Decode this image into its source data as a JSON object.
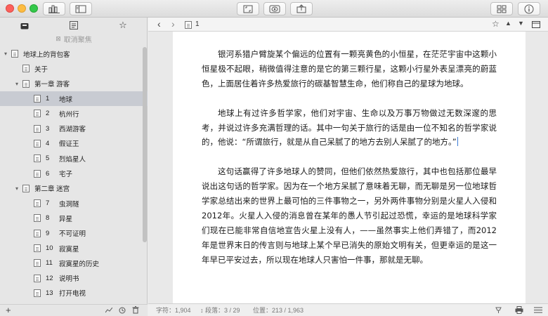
{
  "sidebar": {
    "unfocus_label": "取消聚焦",
    "items": [
      {
        "num": "",
        "label": "地球上的背包客",
        "level": 0,
        "disclosure": "▾",
        "selected": false
      },
      {
        "num": "",
        "label": "关于",
        "level": 1,
        "disclosure": "",
        "selected": false
      },
      {
        "num": "",
        "label": "第一章 游客",
        "level": 1,
        "disclosure": "▾",
        "selected": false
      },
      {
        "num": "1",
        "label": "地球",
        "level": 2,
        "disclosure": "",
        "selected": true
      },
      {
        "num": "2",
        "label": "杭州行",
        "level": 2,
        "disclosure": "",
        "selected": false
      },
      {
        "num": "3",
        "label": "西湖游客",
        "level": 2,
        "disclosure": "",
        "selected": false
      },
      {
        "num": "4",
        "label": "假证王",
        "level": 2,
        "disclosure": "",
        "selected": false
      },
      {
        "num": "5",
        "label": "烈焰星人",
        "level": 2,
        "disclosure": "",
        "selected": false
      },
      {
        "num": "6",
        "label": "宅子",
        "level": 2,
        "disclosure": "",
        "selected": false
      },
      {
        "num": "",
        "label": "第二章 迷宫",
        "level": 1,
        "disclosure": "▾",
        "selected": false
      },
      {
        "num": "7",
        "label": "虫洞隧",
        "level": 2,
        "disclosure": "",
        "selected": false
      },
      {
        "num": "8",
        "label": "异星",
        "level": 2,
        "disclosure": "",
        "selected": false
      },
      {
        "num": "9",
        "label": "不可证明",
        "level": 2,
        "disclosure": "",
        "selected": false
      },
      {
        "num": "10",
        "label": "寂寞星",
        "level": 2,
        "disclosure": "",
        "selected": false
      },
      {
        "num": "11",
        "label": "寂寞星的历史",
        "level": 2,
        "disclosure": "",
        "selected": false
      },
      {
        "num": "12",
        "label": "说明书",
        "level": 2,
        "disclosure": "",
        "selected": false
      },
      {
        "num": "13",
        "label": "打开电视",
        "level": 2,
        "disclosure": "",
        "selected": false
      }
    ]
  },
  "editor": {
    "nav_back": "‹",
    "nav_forward": "›",
    "page_num": "1",
    "paragraphs": [
      "银河系猎户臂旋某个偏远的位置有一颗亮黄色的小恒星，在茫茫宇宙中这颗小恒星极不起眼，稍微值得注意的是它的第三颗行星，这颗小行星外表呈漂亮的蔚蓝色，上面居住着许多热爱旅行的碳基智慧生命，他们称自己的星球为地球。",
      "地球上有过许多哲学家，他们对宇宙、生命以及万事万物做过无数深邃的思考，并说过许多充满哲理的话。其中一句关于旅行的话是由一位不知名的哲学家说的，他说：“所谓旅行，就是从自己呆腻了的地方去别人呆腻了的地方。”",
      "这句话赢得了许多地球人的赞同，但他们依然热爱旅行，其中也包括那位最早说出这句话的哲学家。因为在一个地方呆腻了意味着无聊，而无聊是另一位地球哲学家总结出来的世界上最可怕的三件事物之一，另外两件事物分别是火星人入侵和2012年。火星人入侵的消息曾在某年的愚人节引起过恐慌，幸运的是地球科学家们现在已能非常自信地宣告火星上没有人，——虽然事实上他们弄错了，而2012年是世界末日的传言则与地球上某个早已消失的原始文明有关，但更幸运的是这一年早已平安过去，所以现在地球人只害怕一件事，那就是无聊。"
    ]
  },
  "status": {
    "chars_label": "字符：",
    "chars_value": "1,904",
    "para_label": "段落：",
    "para_value": "3 / 29",
    "pos_label": "位置：",
    "pos_value": "213 / 1,963"
  }
}
